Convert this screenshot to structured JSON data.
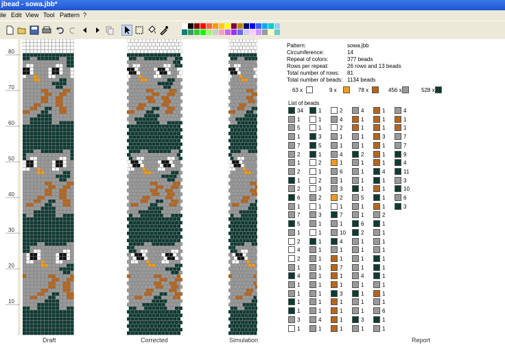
{
  "window": {
    "title": "jbead - sowa.jbb*"
  },
  "menu": [
    "ile",
    "Edit",
    "View",
    "Tool",
    "Pattern",
    "?"
  ],
  "toolbar": {
    "buttons": [
      "new-icon",
      "open-icon",
      "save-icon",
      "print-icon",
      "undo-icon",
      "redo-icon",
      "arrow-left-icon",
      "arrow-right-icon",
      "copy-icon",
      "pointer-icon",
      "select-rect-icon",
      "fill-icon",
      "pick-color-icon"
    ],
    "palette": [
      "#ffffff",
      "#000000",
      "#800000",
      "#ff0000",
      "#ff6633",
      "#ff9900",
      "#ffcc00",
      "#ffff00",
      "#800040",
      "#b8860b",
      "#000080",
      "#0000ff",
      "#3366ff",
      "#00aaff",
      "#00cccc",
      "#99ccff",
      "#008080",
      "#339966",
      "#33cc33",
      "#00ff00",
      "#99ff66",
      "#cccccc",
      "#ff99cc",
      "#cc66ff",
      "#9933ff",
      "#6666ff",
      "#ccccff",
      "#ffccff",
      "#cc99ff",
      "#999999",
      "#ffffcc",
      "#66cccc"
    ]
  },
  "ruler": {
    "labels": [
      "80",
      "70",
      "60",
      "50",
      "40",
      "30",
      "20",
      "10"
    ]
  },
  "panes": {
    "draft": "Draft",
    "corrected": "Corrected",
    "simulation": "Simulation",
    "report": "Report"
  },
  "report": {
    "rows": [
      {
        "k": "Pattern:",
        "v": "sowa.jbb"
      },
      {
        "k": "Circumference:",
        "v": "14"
      },
      {
        "k": "Repeat of colors:",
        "v": "377 beads"
      },
      {
        "k": "Rows per repeat:",
        "v": "26 rows and 13 beads"
      },
      {
        "k": "Total number of rows:",
        "v": "81"
      },
      {
        "k": "Total number of beads:",
        "v": "1134 beads"
      }
    ],
    "color_counts": [
      {
        "n": "63 x",
        "color": "#ffffff"
      },
      {
        "n": "9 x",
        "color": "#f39a1c"
      },
      {
        "n": "78 x",
        "color": "#b8651a"
      },
      {
        "n": "456 x",
        "color": "#9a9a9a"
      },
      {
        "n": "528 x",
        "color": "#0e3b33"
      }
    ],
    "list_title": "List of beads",
    "bead_list": [
      [
        [
          "dark",
          "34"
        ],
        [
          "grey",
          "1"
        ],
        [
          "grey",
          "5"
        ],
        [
          "grey",
          "1"
        ],
        [
          "grey",
          "7"
        ],
        [
          "grey",
          "2"
        ],
        [
          "grey",
          "1"
        ],
        [
          "grey",
          "2"
        ],
        [
          "dark",
          "1"
        ],
        [
          "grey",
          "2"
        ],
        [
          "dark",
          "6"
        ],
        [
          "grey",
          "1"
        ],
        [
          "grey",
          "7"
        ],
        [
          "dark",
          "5"
        ],
        [
          "grey",
          "1"
        ],
        [
          "white",
          "2"
        ],
        [
          "white",
          "4"
        ],
        [
          "white",
          "2"
        ],
        [
          "grey",
          "1"
        ],
        [
          "dark",
          "4"
        ],
        [
          "grey",
          "1"
        ],
        [
          "grey",
          "1"
        ],
        [
          "dark",
          "1"
        ],
        [
          "dark",
          "1"
        ],
        [
          "grey",
          "3"
        ],
        [
          "white",
          "1"
        ]
      ],
      [
        [
          "dark",
          "1"
        ],
        [
          "white",
          "1"
        ],
        [
          "white",
          "1"
        ],
        [
          "dark",
          "3"
        ],
        [
          "dark",
          "5"
        ],
        [
          "dark",
          "1"
        ],
        [
          "white",
          "2"
        ],
        [
          "white",
          "1"
        ],
        [
          "white",
          "2"
        ],
        [
          "white",
          "3"
        ],
        [
          "grey",
          "2"
        ],
        [
          "white",
          "1"
        ],
        [
          "grey",
          "3"
        ],
        [
          "grey",
          "1"
        ],
        [
          "white",
          "1"
        ],
        [
          "dark",
          "1"
        ],
        [
          "grey",
          "1"
        ],
        [
          "grey",
          "1"
        ],
        [
          "grey",
          "1"
        ],
        [
          "grey",
          "1"
        ],
        [
          "grey",
          "1"
        ],
        [
          "grey",
          "1"
        ],
        [
          "grey",
          "1"
        ],
        [
          "grey",
          "1"
        ],
        [
          "grey",
          "4"
        ],
        [
          "grey",
          "1"
        ]
      ],
      [
        [
          "white",
          "2"
        ],
        [
          "grey",
          "4"
        ],
        [
          "white",
          "2"
        ],
        [
          "grey",
          "1"
        ],
        [
          "grey",
          "1"
        ],
        [
          "grey",
          "4"
        ],
        [
          "orange",
          "1"
        ],
        [
          "grey",
          "6"
        ],
        [
          "grey",
          "1"
        ],
        [
          "grey",
          "3"
        ],
        [
          "orange",
          "2"
        ],
        [
          "white",
          "1"
        ],
        [
          "dark",
          "7"
        ],
        [
          "grey",
          "1"
        ],
        [
          "grey",
          "10"
        ],
        [
          "dark",
          "4"
        ],
        [
          "grey",
          "1"
        ],
        [
          "brown",
          "1"
        ],
        [
          "brown",
          "7"
        ],
        [
          "brown",
          "1"
        ],
        [
          "brown",
          "1"
        ],
        [
          "dark",
          "3"
        ],
        [
          "brown",
          "1"
        ],
        [
          "brown",
          "1"
        ],
        [
          "brown",
          "1"
        ],
        [
          "brown",
          "1"
        ]
      ],
      [
        [
          "grey",
          "4"
        ],
        [
          "brown",
          "1"
        ],
        [
          "brown",
          "1"
        ],
        [
          "grey",
          "1"
        ],
        [
          "grey",
          "1"
        ],
        [
          "dark",
          "2"
        ],
        [
          "grey",
          "1"
        ],
        [
          "grey",
          "1"
        ],
        [
          "grey",
          "1"
        ],
        [
          "dark",
          "1"
        ],
        [
          "grey",
          "5"
        ],
        [
          "grey",
          "1"
        ],
        [
          "grey",
          "1"
        ],
        [
          "dark",
          "6"
        ],
        [
          "dark",
          "2"
        ],
        [
          "grey",
          "1"
        ],
        [
          "grey",
          "1"
        ],
        [
          "grey",
          "1"
        ],
        [
          "grey",
          "1"
        ],
        [
          "grey",
          "4"
        ],
        [
          "grey",
          "1"
        ],
        [
          "dark",
          "1"
        ],
        [
          "grey",
          "1"
        ],
        [
          "grey",
          "1"
        ],
        [
          "dark",
          "3"
        ],
        [
          "grey",
          "1"
        ]
      ],
      [
        [
          "brown",
          "1"
        ],
        [
          "brown",
          "1"
        ],
        [
          "brown",
          "1"
        ],
        [
          "brown",
          "3"
        ],
        [
          "brown",
          "1"
        ],
        [
          "brown",
          "1"
        ],
        [
          "brown",
          "1"
        ],
        [
          "dark",
          "4"
        ],
        [
          "dark",
          "1"
        ],
        [
          "brown",
          "1"
        ],
        [
          "dark",
          "1"
        ],
        [
          "brown",
          "1"
        ],
        [
          "grey",
          "2"
        ],
        [
          "dark",
          "1"
        ],
        [
          "grey",
          "1"
        ],
        [
          "grey",
          "1"
        ],
        [
          "grey",
          "1"
        ],
        [
          "dark",
          "1"
        ],
        [
          "dark",
          "1"
        ],
        [
          "dark",
          "1"
        ],
        [
          "grey",
          "1"
        ],
        [
          "brown",
          "1"
        ],
        [
          "grey",
          "1"
        ],
        [
          "grey",
          "6"
        ],
        [
          "dark",
          "1"
        ],
        [
          "grey",
          "1"
        ]
      ],
      [
        [
          "grey",
          "4"
        ],
        [
          "brown",
          "1"
        ],
        [
          "brown",
          "1"
        ],
        [
          "grey",
          "7"
        ],
        [
          "grey",
          "7"
        ],
        [
          "dark",
          "9"
        ],
        [
          "dark",
          "4"
        ],
        [
          "dark",
          "11"
        ],
        [
          "grey",
          "3"
        ],
        [
          "dark",
          "10"
        ],
        [
          "grey",
          "6"
        ],
        [
          "dark",
          "3"
        ]
      ]
    ]
  }
}
